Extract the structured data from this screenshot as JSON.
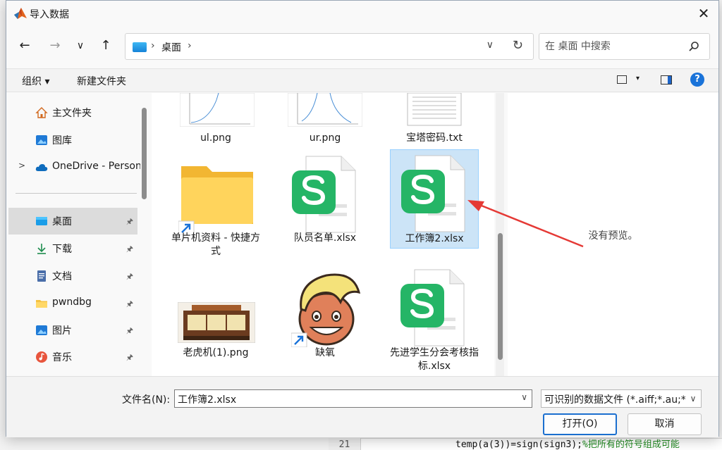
{
  "window": {
    "title": "导入数据",
    "close_glyph": "✕"
  },
  "nav": {
    "back_glyph": "←",
    "forward_glyph": "→",
    "recent_glyph": "∨",
    "up_glyph": "↑",
    "address_sep": "›",
    "address_location": "桌面",
    "address_dropdown_glyph": "∨",
    "refresh_glyph": "↻",
    "search_placeholder": "在 桌面 中搜索"
  },
  "toolbar": {
    "organize_label": "组织 ▾",
    "new_folder_label": "新建文件夹",
    "view_arrow": "▾",
    "help_label": "?"
  },
  "sidebar": {
    "items": [
      {
        "label": "主文件夹"
      },
      {
        "label": "图库"
      },
      {
        "label": "OneDrive - Personal"
      },
      {
        "label": "桌面"
      },
      {
        "label": "下载"
      },
      {
        "label": "文档"
      },
      {
        "label": "pwndbg"
      },
      {
        "label": "图片"
      },
      {
        "label": "音乐"
      }
    ],
    "pin_glyph": "📌",
    "chevron_glyph": ">"
  },
  "files": [
    {
      "name": "ul.png"
    },
    {
      "name": "ur.png"
    },
    {
      "name": "宝塔密码.txt"
    },
    {
      "name": "单片机资料 - 快捷方式"
    },
    {
      "name": "队员名单.xlsx"
    },
    {
      "name": "工作簿2.xlsx"
    },
    {
      "name": "老虎机(1).png"
    },
    {
      "name": "缺氧"
    },
    {
      "name": "先进学生分会考核指标.xlsx"
    }
  ],
  "preview": {
    "empty_text": "没有预览。"
  },
  "bottom": {
    "filename_label": "文件名(N):",
    "filename_value": "工作簿2.xlsx",
    "filetype_value": "可识别的数据文件 (*.aiff;*.au;*.avi",
    "open_label": "打开(O)",
    "cancel_label": "取消",
    "dropdown_glyph": "∨"
  },
  "background": {
    "line_number": "21",
    "code": "temp(a(3))=sign(sign3);",
    "comment": "%把所有的符号组成可能"
  },
  "colors": {
    "accent": "#1b6fcf",
    "selection_bg": "#cce4f7",
    "wps_green": "#25b566",
    "annotation_red": "#e53935"
  }
}
